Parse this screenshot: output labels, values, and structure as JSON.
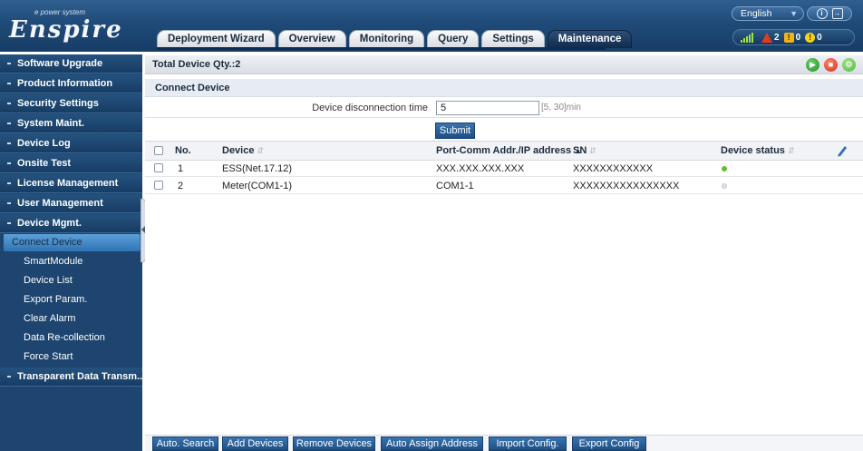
{
  "header": {
    "logo_small": "e power system",
    "logo_big": "Enspire",
    "tabs": [
      "Deployment Wizard",
      "Overview",
      "Monitoring",
      "Query",
      "Settings",
      "Maintenance"
    ],
    "active_tab": "Maintenance",
    "language": "English",
    "alarms": {
      "critical": "2",
      "major": "0",
      "minor": "0"
    }
  },
  "sidebar": {
    "items": [
      "Software Upgrade",
      "Product Information",
      "Security Settings",
      "System Maint.",
      "Device Log",
      "Onsite Test",
      "License Management",
      "User Management",
      "Device Mgmt."
    ],
    "sub_items": [
      "Connect Device",
      "SmartModule",
      "Device List",
      "Export Param.",
      "Clear Alarm",
      "Data Re-collection",
      "Force Start"
    ],
    "active_sub": "Connect Device",
    "last_item": "Transparent Data Transm..."
  },
  "main": {
    "total_label": "Total Device Qty.:2",
    "section_title": "Connect Device",
    "form": {
      "label": "Device disconnection time",
      "value": "5",
      "range": "[5, 30]min",
      "submit": "Submit"
    },
    "columns": [
      "No.",
      "Device",
      "Port-Comm Addr./IP address",
      "SN",
      "Device status"
    ],
    "rows": [
      {
        "no": "1",
        "device": "ESS(Net.17.12)",
        "address": "XXX.XXX.XXX.XXX",
        "sn": "XXXXXXXXXXXX",
        "status": "online"
      },
      {
        "no": "2",
        "device": "Meter(COM1-1)",
        "address": "COM1-1",
        "sn": "XXXXXXXXXXXXXXXX",
        "status": "offline"
      }
    ],
    "buttons": [
      "Auto. Search",
      "Add Devices",
      "Remove Devices",
      "Auto Assign Address",
      "Import Config.",
      "Export Config"
    ]
  },
  "colors": {
    "header_bg": "#1f4a78",
    "sidebar_bg": "#1d456f",
    "button_blue": "#1c4f86",
    "status_online": "#5cc02c",
    "status_offline": "#dde1e6"
  }
}
